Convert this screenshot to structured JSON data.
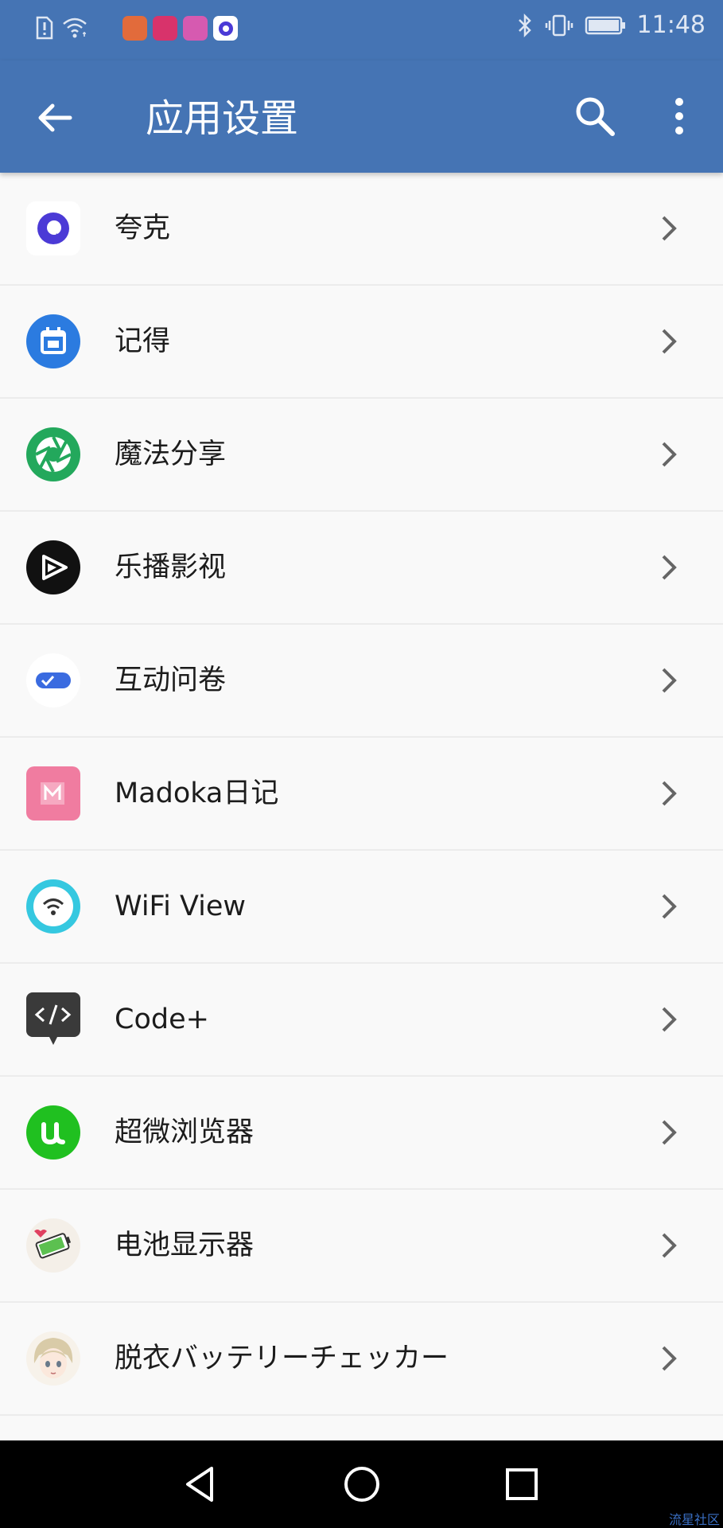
{
  "status_bar": {
    "time": "11:48",
    "app_icons": [
      {
        "name": "uc-browser-icon",
        "color": "#e26b3b"
      },
      {
        "name": "mall-icon",
        "color": "#d8336b"
      },
      {
        "name": "cartoon-app-icon",
        "color": "#d65ab0"
      },
      {
        "name": "quark-icon",
        "color": "#4b3ad6"
      }
    ]
  },
  "app_bar": {
    "title": "应用设置",
    "back_icon": "arrow-left-icon",
    "search_icon": "search-icon",
    "more_icon": "more-vert-icon"
  },
  "apps": [
    {
      "label": "夸克",
      "icon": "quark-icon",
      "color": "#4b3ad6"
    },
    {
      "label": "记得",
      "icon": "calendar-icon",
      "color": "#2b7be0"
    },
    {
      "label": "魔法分享",
      "icon": "aperture-icon",
      "color": "#23a85c"
    },
    {
      "label": "乐播影视",
      "icon": "play-icon",
      "color": "#111111"
    },
    {
      "label": "互动问卷",
      "icon": "checkbox-toggle-icon",
      "color": "#3a6be0"
    },
    {
      "label": "Madoka日记",
      "icon": "madoka-icon",
      "color": "#f07ca0"
    },
    {
      "label": "WiFi View",
      "icon": "wifi-icon",
      "color": "#35c8e0"
    },
    {
      "label": "Code+",
      "icon": "code-bubble-icon",
      "color": "#3a3a3a"
    },
    {
      "label": "超微浏览器",
      "icon": "u-browser-icon",
      "color": "#20c020"
    },
    {
      "label": "电池显示器",
      "icon": "battery-sticker-icon",
      "color": "#5cc050"
    },
    {
      "label": "脱衣バッテリーチェッカー",
      "icon": "anime-girl-icon",
      "color": "#d9cba8"
    },
    {
      "label": "",
      "icon": "partial-app-icon",
      "color": "#1f4e9e"
    }
  ],
  "nav_bar": {
    "back": "nav-back-icon",
    "home": "nav-home-icon",
    "recents": "nav-recents-icon"
  },
  "watermark": "流星社区"
}
